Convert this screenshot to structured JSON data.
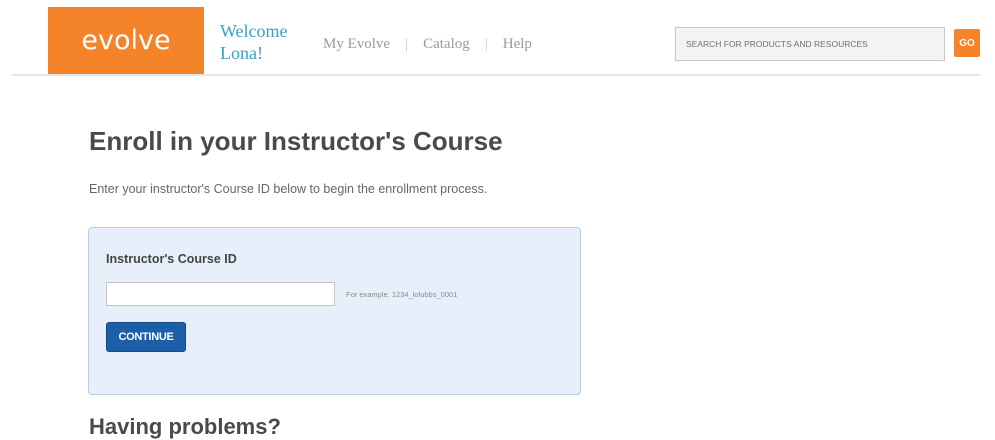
{
  "header": {
    "logo_text": "evolve",
    "welcome_line1": "Welcome",
    "welcome_line2": "Lona!",
    "nav": [
      {
        "label": "My Evolve"
      },
      {
        "label": "Catalog"
      },
      {
        "label": "Help"
      }
    ],
    "nav_separator": "|",
    "search_placeholder": "SEARCH FOR PRODUCTS AND RESOURCES",
    "go_label": "GO",
    "accent_color": "#f4832a"
  },
  "main": {
    "title": "Enroll in your Instructor's Course",
    "intro": "Enter your instructor's Course ID below to begin the enrollment process.",
    "form": {
      "field_label": "Instructor's Course ID",
      "course_id_value": "",
      "example_hint": "For example, 1234_lolubbs_0001",
      "continue_label": "CONTINUE",
      "button_color": "#1c5fa8",
      "panel_color": "#e7f0fa"
    },
    "problems_heading": "Having problems?"
  }
}
